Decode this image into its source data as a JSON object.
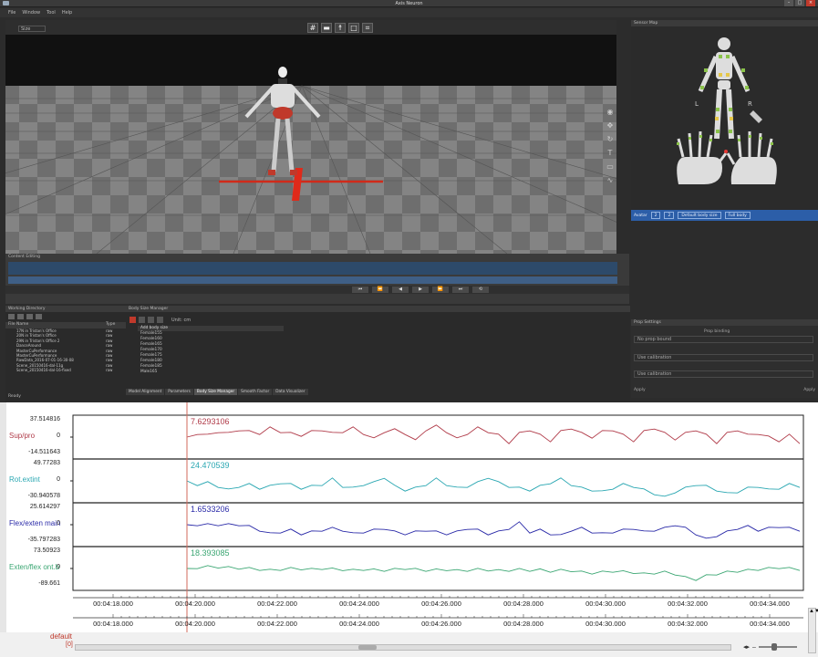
{
  "window": {
    "title": "Axis Neuron",
    "controls": [
      "–",
      "□",
      "×"
    ]
  },
  "menu": [
    "File",
    "Window",
    "Tool",
    "Help"
  ],
  "toolbar": {
    "size_select": "Size",
    "view_icons": [
      "grid-icon",
      "floor-icon",
      "skeleton-icon",
      "camera-icon",
      "layout-icon"
    ]
  },
  "panels": {
    "sensor_map": "Sensor Map",
    "timeline": "Content Editing",
    "files": "Working Directory",
    "body_size": "Body Size Manager",
    "props": "Prop Settings"
  },
  "sensor": {
    "left": "L",
    "right": "R"
  },
  "profile": {
    "user": "Avatar",
    "f1": "2",
    "f2": "2",
    "preset": "Default body size",
    "mode": "Full body"
  },
  "props": {
    "heading": "Prop binding",
    "drop": "No prop bound",
    "row1": "Use calibration",
    "row2": "Use calibration",
    "footer_left": "Apply",
    "footer_right": "Apply"
  },
  "files": {
    "cols": {
      "name": "File Name",
      "type": "Type"
    },
    "rows": [
      {
        "name": "17N in Tristan's Office",
        "type": "raw"
      },
      {
        "name": "20N in Tristan's Office",
        "type": "raw"
      },
      {
        "name": "29N in Tristan's Office 2",
        "type": "raw"
      },
      {
        "name": "DanceAround",
        "type": "raw"
      },
      {
        "name": "MasterCuPerformance",
        "type": "raw"
      },
      {
        "name": "MasterCuPerformance",
        "type": "raw"
      },
      {
        "name": "RawData_2016-07-01-16-30-08",
        "type": "raw"
      },
      {
        "name": "Scene_20150416-dal-11g",
        "type": "raw"
      },
      {
        "name": "Scene_20150416-dal-16-fixed",
        "type": "raw"
      }
    ],
    "status": "Ready"
  },
  "body_size": {
    "unit_label": "Unit: cm",
    "add_label": "Add body size",
    "items": [
      "Female155",
      "Female160",
      "Female165",
      "Female170",
      "Female175",
      "Female180",
      "Female185",
      "Male165"
    ],
    "tabs": [
      "Model Alignment",
      "Parameters",
      "Body Size Manager",
      "Smooth Factor",
      "Data Visualizer"
    ],
    "active_tab": 2
  },
  "chart_data": {
    "type": "line",
    "x_axis_labels": [
      "00:04:18.000",
      "00:04:20.000",
      "00:04:22.000",
      "00:04:24.000",
      "00:04:26.000",
      "00:04:28.000",
      "00:04:30.000",
      "00:04:32.000",
      "00:04:34.000"
    ],
    "cursor_time": "00:04:20.000",
    "series": [
      {
        "name": "Sup/pro",
        "color": "#b03a48",
        "max": "37.514816",
        "zero": "0",
        "min": "-14.511643",
        "cursor_value": "7.6293106",
        "values": [
          0,
          0.2,
          0.1,
          0.3,
          0.2,
          0.4,
          0.3,
          0.2,
          0.5,
          0.3,
          0.2,
          0.1,
          0.3,
          0.4,
          0.2,
          0.3,
          0.5,
          0.2,
          -0.1,
          0.3,
          0.4,
          0.2,
          -0.2,
          0.4,
          0.6,
          0.3,
          -0.1,
          0.2,
          0.5,
          0.3,
          0.1,
          -0.3,
          0.2,
          0.4,
          0.1,
          -0.2,
          0.3,
          0.5,
          0.2,
          0.0,
          0.3,
          0.4,
          0.1,
          -0.2,
          0.3,
          0.5,
          0.2,
          -0.1,
          0.2,
          0.4,
          0.1,
          -0.3,
          0.2,
          0.4,
          0.1,
          0.2,
          0.0,
          -0.2,
          0.1,
          -0.3
        ]
      },
      {
        "name": "Rot.extint",
        "color": "#2aa7b2",
        "max": "49.77283",
        "zero": "0",
        "min": "-30.940578",
        "cursor_value": "24.470539",
        "values": [
          0,
          -0.2,
          -0.1,
          -0.3,
          -0.5,
          -0.3,
          -0.2,
          -0.4,
          -0.3,
          -0.1,
          -0.2,
          -0.4,
          -0.3,
          -0.2,
          0.1,
          -0.3,
          -0.4,
          -0.2,
          -0.1,
          0.2,
          -0.3,
          -0.5,
          -0.4,
          -0.2,
          0.1,
          -0.2,
          -0.4,
          -0.3,
          -0.1,
          0.2,
          -0.1,
          -0.3,
          -0.4,
          -0.5,
          -0.3,
          -0.1,
          0.1,
          -0.2,
          -0.4,
          -0.5,
          -0.6,
          -0.4,
          -0.2,
          -0.3,
          -0.5,
          -0.7,
          -0.9,
          -0.6,
          -0.4,
          -0.2,
          -0.3,
          -0.5,
          -0.7,
          -0.6,
          -0.4,
          -0.3,
          -0.5,
          -0.4,
          -0.2,
          -0.3
        ]
      },
      {
        "name": "Flex/exten main",
        "color": "#2a2aa8",
        "max": "25.614297",
        "zero": "0",
        "min": "-35.797283",
        "cursor_value": "1.6533206",
        "values": [
          0,
          0,
          0,
          0,
          0,
          0,
          -0.1,
          -0.3,
          -0.5,
          -0.4,
          -0.3,
          -0.5,
          -0.4,
          -0.3,
          -0.2,
          -0.3,
          -0.5,
          -0.4,
          -0.3,
          -0.2,
          -0.4,
          -0.5,
          -0.4,
          -0.3,
          -0.4,
          -0.5,
          -0.4,
          -0.2,
          -0.3,
          -0.5,
          -0.4,
          -0.2,
          0.1,
          -0.4,
          -0.3,
          -0.5,
          -0.6,
          -0.3,
          -0.2,
          -0.4,
          -0.5,
          -0.4,
          -0.3,
          -0.2,
          -0.4,
          -0.3,
          -0.2,
          0.0,
          -0.2,
          -0.5,
          -0.8,
          -0.6,
          -0.4,
          -0.2,
          -0.1,
          -0.3,
          -0.2,
          -0.1,
          -0.2,
          -0.3
        ]
      },
      {
        "name": "Exten/flex ont.b",
        "color": "#3aa672",
        "max": "73.50923",
        "zero": "0",
        "min": "-89.661",
        "cursor_value": "18.393085",
        "values": [
          0,
          0.05,
          0.1,
          0.08,
          0.05,
          0.02,
          0.0,
          -0.05,
          -0.1,
          -0.05,
          0.0,
          -0.02,
          -0.05,
          0.0,
          -0.03,
          -0.06,
          -0.1,
          -0.05,
          -0.08,
          -0.1,
          -0.05,
          0.0,
          -0.05,
          -0.1,
          -0.08,
          -0.06,
          -0.12,
          -0.1,
          -0.05,
          -0.08,
          -0.12,
          -0.1,
          -0.06,
          -0.1,
          -0.08,
          -0.15,
          -0.1,
          -0.12,
          -0.2,
          -0.25,
          -0.2,
          -0.15,
          -0.18,
          -0.22,
          -0.3,
          -0.25,
          -0.2,
          -0.3,
          -0.5,
          -0.6,
          -0.4,
          -0.3,
          -0.2,
          -0.15,
          -0.1,
          -0.05,
          0.0,
          0.05,
          0.0,
          -0.05
        ]
      }
    ]
  },
  "plot_footer": {
    "default_label": "default",
    "zero_label": "[0]",
    "vscroll": "▲▼"
  }
}
